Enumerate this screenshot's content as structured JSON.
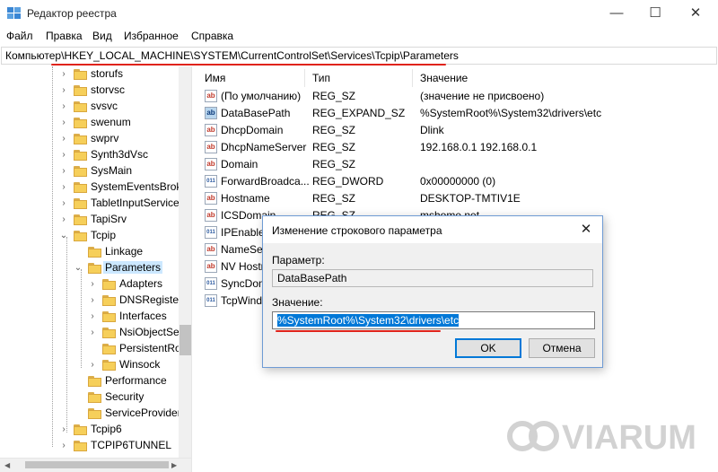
{
  "window": {
    "title": "Редактор реестра",
    "controls": {
      "minimize": "—",
      "maximize": "☐",
      "close": "✕"
    }
  },
  "menu": [
    "Файл",
    "Правка",
    "Вид",
    "Избранное",
    "Справка"
  ],
  "address": "Компьютер\\HKEY_LOCAL_MACHINE\\SYSTEM\\CurrentControlSet\\Services\\Tcpip\\Parameters",
  "tree": [
    {
      "label": "storufs",
      "chevron": "›"
    },
    {
      "label": "storvsc",
      "chevron": "›"
    },
    {
      "label": "svsvc",
      "chevron": "›"
    },
    {
      "label": "swenum",
      "chevron": "›"
    },
    {
      "label": "swprv",
      "chevron": "›"
    },
    {
      "label": "Synth3dVsc",
      "chevron": "›"
    },
    {
      "label": "SysMain",
      "chevron": "›"
    },
    {
      "label": "SystemEventsBrok",
      "chevron": "›"
    },
    {
      "label": "TabletInputService",
      "chevron": "›"
    },
    {
      "label": "TapiSrv",
      "chevron": "›"
    },
    {
      "label": "Tcpip",
      "chevron": "⌄"
    },
    {
      "label": "Linkage",
      "chevron": ""
    },
    {
      "label": "Parameters",
      "chevron": "⌄"
    },
    {
      "label": "Adapters",
      "chevron": "›"
    },
    {
      "label": "DNSRegister",
      "chevron": "›"
    },
    {
      "label": "Interfaces",
      "chevron": "›"
    },
    {
      "label": "NsiObjectSe",
      "chevron": "›"
    },
    {
      "label": "PersistentRo",
      "chevron": ""
    },
    {
      "label": "Winsock",
      "chevron": "›"
    },
    {
      "label": "Performance",
      "chevron": ""
    },
    {
      "label": "Security",
      "chevron": ""
    },
    {
      "label": "ServiceProvider",
      "chevron": ""
    },
    {
      "label": "Tcpip6",
      "chevron": "›"
    },
    {
      "label": "TCPIP6TUNNEL",
      "chevron": "›"
    }
  ],
  "columns": {
    "name": "Имя",
    "type": "Тип",
    "value": "Значение"
  },
  "values": [
    {
      "icon": "ab",
      "name": "(По умолчанию)",
      "type": "REG_SZ",
      "data": "(значение не присвоено)"
    },
    {
      "icon": "ab",
      "name": "DataBasePath",
      "type": "REG_EXPAND_SZ",
      "data": "%SystemRoot%\\System32\\drivers\\etc"
    },
    {
      "icon": "ab",
      "name": "DhcpDomain",
      "type": "REG_SZ",
      "data": "Dlink"
    },
    {
      "icon": "ab",
      "name": "DhcpNameServer",
      "type": "REG_SZ",
      "data": "192.168.0.1 192.168.0.1"
    },
    {
      "icon": "ab",
      "name": "Domain",
      "type": "REG_SZ",
      "data": ""
    },
    {
      "icon": "011",
      "name": "ForwardBroadca...",
      "type": "REG_DWORD",
      "data": "0x00000000 (0)"
    },
    {
      "icon": "ab",
      "name": "Hostname",
      "type": "REG_SZ",
      "data": "DESKTOP-TMTIV1E"
    },
    {
      "icon": "ab",
      "name": "ICSDomain",
      "type": "REG_SZ",
      "data": "mshome.net"
    },
    {
      "icon": "011",
      "name": "IPEnableR",
      "type": "",
      "data": ""
    },
    {
      "icon": "ab",
      "name": "NameSer",
      "type": "",
      "data": ""
    },
    {
      "icon": "ab",
      "name": "NV Hostn",
      "type": "",
      "data": ""
    },
    {
      "icon": "011",
      "name": "SyncDom",
      "type": "",
      "data": ""
    },
    {
      "icon": "011",
      "name": "TcpWind",
      "type": "",
      "data": ""
    }
  ],
  "dialog": {
    "title": "Изменение строкового параметра",
    "close": "✕",
    "param_label": "Параметр:",
    "param_value": "DataBasePath",
    "value_label": "Значение:",
    "value": "%SystemRoot%\\System32\\drivers\\etc",
    "ok": "OK",
    "cancel": "Отмена"
  },
  "watermark": "VIARUM",
  "colors": {
    "highlight": "#e0231a",
    "selection": "#0078d7",
    "tree_selection": "#cce8ff"
  }
}
